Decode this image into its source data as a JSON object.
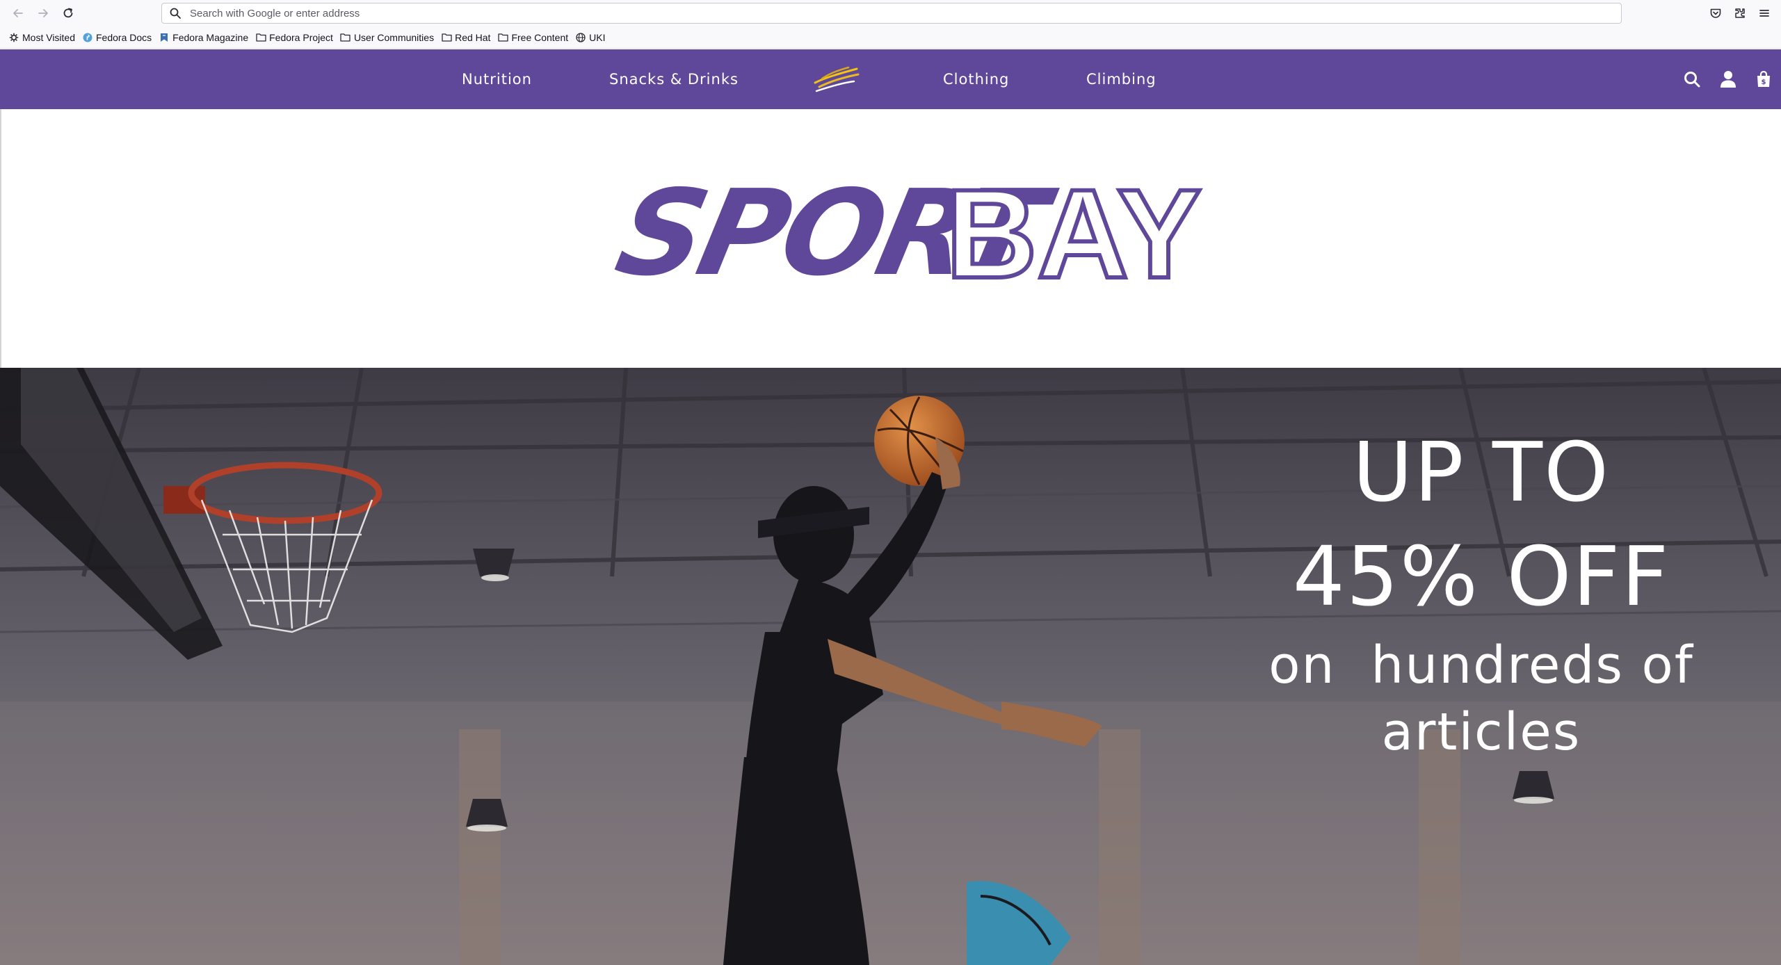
{
  "browser": {
    "url_placeholder": "Search with Google or enter address",
    "icons": {
      "back": "arrow-left-icon",
      "forward": "arrow-right-icon",
      "reload": "reload-icon",
      "pocket": "pocket-icon",
      "extensions": "extensions-icon",
      "menu": "hamburger-menu-icon"
    },
    "bookmarks": [
      {
        "label": "Most Visited",
        "icon": "gear-icon"
      },
      {
        "label": "Fedora Docs",
        "icon": "fedora-icon"
      },
      {
        "label": "Fedora Magazine",
        "icon": "bookmark-flag-icon"
      },
      {
        "label": "Fedora Project",
        "icon": "folder-icon"
      },
      {
        "label": "User Communities",
        "icon": "folder-icon"
      },
      {
        "label": "Red Hat",
        "icon": "folder-icon"
      },
      {
        "label": "Free Content",
        "icon": "folder-icon"
      },
      {
        "label": "UKI",
        "icon": "globe-icon"
      }
    ]
  },
  "site": {
    "nav": {
      "nutrition": "Nutrition",
      "snacks": "Snacks & Drinks",
      "clothing": "Clothing",
      "climbing": "Climbing"
    },
    "header_icons": {
      "search": "search-icon",
      "account": "user-icon",
      "cart": "shopping-bag-icon"
    },
    "brand": {
      "part1": "SPORT",
      "part2": "BAY"
    },
    "hero": {
      "line1": "UP TO",
      "line2": "45% OFF",
      "line3a": "on  hundreds of",
      "line3b": "articles"
    }
  },
  "colors": {
    "brand_purple": "#5f4799",
    "header_text": "#ffffff",
    "chrome_bg": "#f9f9fb"
  }
}
